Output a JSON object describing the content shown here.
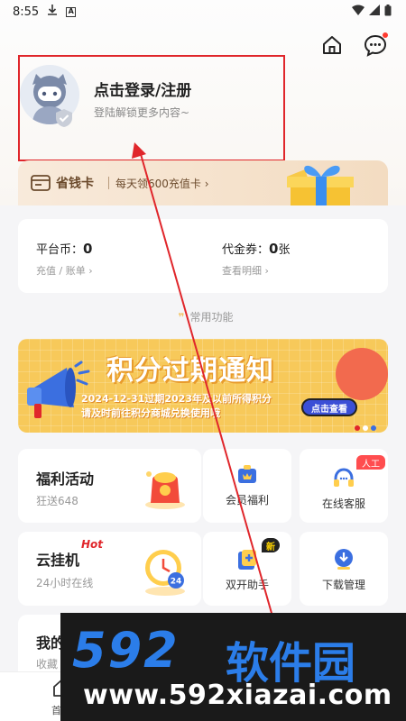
{
  "status_bar": {
    "time": "8:55"
  },
  "profile": {
    "login_title": "点击登录/注册",
    "login_subtitle": "登陆解锁更多内容~"
  },
  "vip_card": {
    "name": "省钱卡",
    "description": "每天领600充值卡",
    "arrow": "›"
  },
  "wallet": {
    "coins_label": "平台币：",
    "coins_value": "0",
    "coins_link": "充值 / 账单",
    "voucher_label": "代金券：",
    "voucher_value": "0",
    "voucher_unit": "张",
    "voucher_link": "查看明细",
    "link_arrow": "›"
  },
  "section": {
    "title": "常用功能",
    "quote": "❞"
  },
  "banner": {
    "title": "积分过期通知",
    "line1": "2024-12-31过期2023年及以前所得积分",
    "line2": "请及时前往积分商城兑换使用哦",
    "button": "点击查看"
  },
  "features": {
    "welfare": {
      "title": "福利活动",
      "subtitle": "狂送648"
    },
    "member": {
      "label": "会员福利"
    },
    "service": {
      "label": "在线客服",
      "badge": "人工"
    },
    "cloud": {
      "title": "云挂机",
      "subtitle": "24小时在线",
      "badge": "Hot"
    },
    "dual": {
      "label": "双开助手",
      "badge": "新"
    },
    "download": {
      "label": "下载管理"
    },
    "my": {
      "title": "我的",
      "subtitle": "收藏"
    }
  },
  "bottom_nav": {
    "home_label": "首"
  },
  "watermark": {
    "number": "592",
    "name": "软件园",
    "url": "www.592xiazai.com"
  },
  "colors": {
    "accent_red": "#e0262b",
    "brand_blue": "#2b7de9",
    "banner_yellow": "#f7c95a"
  }
}
